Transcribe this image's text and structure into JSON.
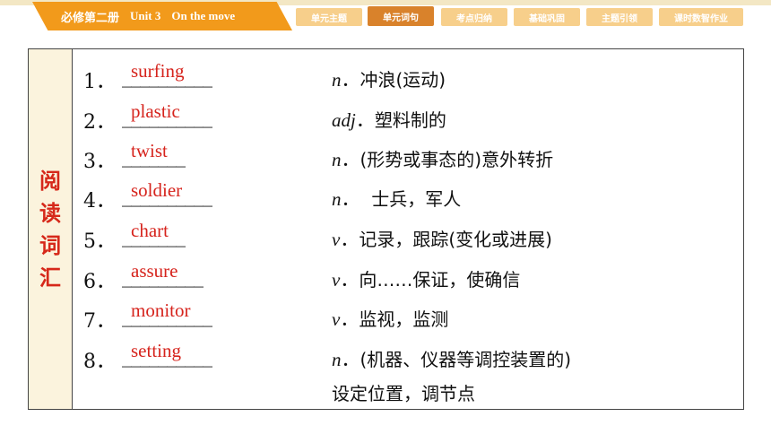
{
  "header": {
    "book": "必修第二册",
    "unit": "Unit 3",
    "unit_title": "On the move",
    "tabs": [
      {
        "label": "单元主题"
      },
      {
        "label": "单元词句"
      },
      {
        "label": "考点归纳"
      },
      {
        "label": "基础巩固"
      },
      {
        "label": "主题引领"
      },
      {
        "label": "课时数智作业"
      }
    ],
    "active_tab": "单元词句"
  },
  "section": {
    "chars": [
      "阅",
      "读",
      "词",
      "汇"
    ]
  },
  "rows": [
    {
      "num": "1．",
      "blank": "__________",
      "answer": "surfing",
      "pos": "n",
      "sep": "．",
      "def": "冲浪(运动)"
    },
    {
      "num": "2．",
      "blank": "__________",
      "answer": "plastic",
      "pos": "adj",
      "sep": "．",
      "def": "塑料制的"
    },
    {
      "num": "3．",
      "blank": "_______",
      "answer": "twist",
      "pos": "n",
      "sep": "．",
      "def": "(形势或事态的)意外转折"
    },
    {
      "num": "4．",
      "blank": "__________",
      "answer": "soldier",
      "pos": "n",
      "sep": "．",
      "def": "  士兵，军人"
    },
    {
      "num": "5．",
      "blank": "_______",
      "answer": "chart",
      "pos": "v",
      "sep": "．",
      "def": "记录，跟踪(变化或进展)"
    },
    {
      "num": "6．",
      "blank": "_________",
      "answer": "assure",
      "pos": "v",
      "sep": "．",
      "def": "向……保证，使确信"
    },
    {
      "num": "7．",
      "blank": "__________",
      "answer": "monitor",
      "pos": "v",
      "sep": "．",
      "def": "监视，监测"
    },
    {
      "num": "8．",
      "blank": "__________",
      "answer": "setting",
      "pos": "n",
      "sep": "．",
      "def": "(机器、仪器等调控装置的)"
    }
  ],
  "continuation": "设定位置，调节点",
  "colors": {
    "accent": "#f29a1b",
    "answer": "#d6231c",
    "tab": "#f7cf8b",
    "tab_active": "#d9822b",
    "side_bg": "#fbf3dd"
  }
}
